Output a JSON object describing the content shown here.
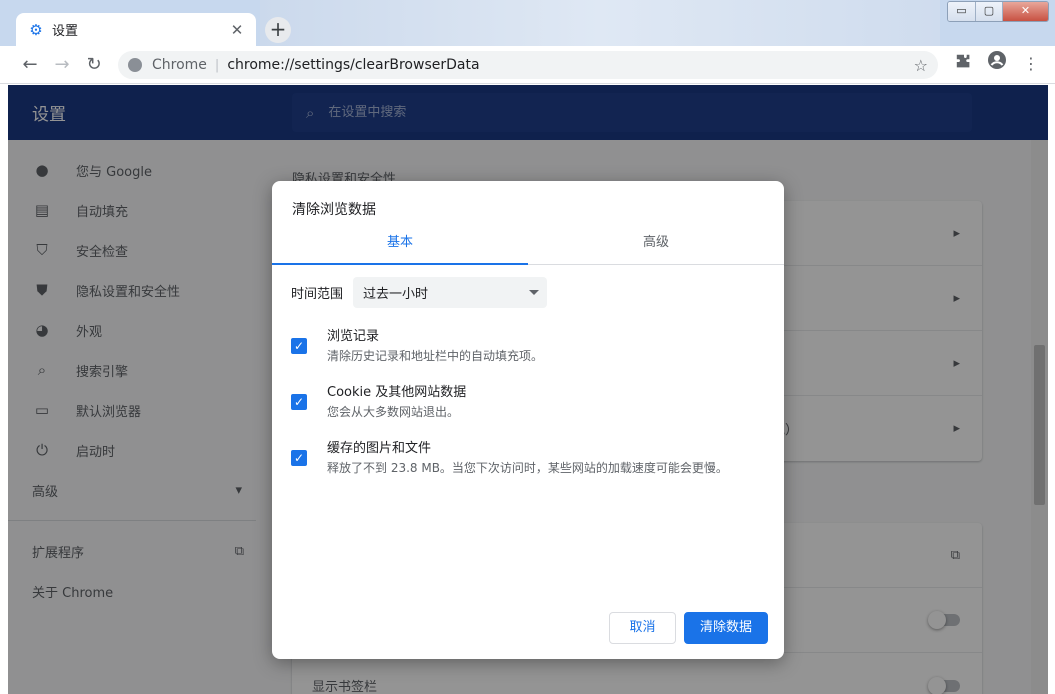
{
  "window": {
    "tab_title": "设置",
    "tab_close": "✕",
    "new_tab": "+",
    "controls": [
      "▭",
      "▢",
      "✕"
    ]
  },
  "toolbar": {
    "back": "←",
    "forward": "→",
    "reload": "↻",
    "site_chip": "Chrome",
    "url": "chrome://settings/clearBrowserData",
    "bookmark_star": "☆",
    "extensions_icon": "extension-icon",
    "profile_icon": "account-icon",
    "menu": "⋮"
  },
  "settings": {
    "title": "设置",
    "search_placeholder": "在设置中搜索",
    "sidebar": [
      {
        "label": "您与 Google",
        "icon": "person-icon"
      },
      {
        "label": "自动填充",
        "icon": "clipboard-icon"
      },
      {
        "label": "安全检查",
        "icon": "shield-check-icon"
      },
      {
        "label": "隐私设置和安全性",
        "icon": "shield-icon"
      },
      {
        "label": "外观",
        "icon": "palette-icon"
      },
      {
        "label": "搜索引擎",
        "icon": "search-icon"
      },
      {
        "label": "默认浏览器",
        "icon": "browser-icon"
      },
      {
        "label": "启动时",
        "icon": "power-icon"
      }
    ],
    "advanced": "高级",
    "extensions": "扩展程序",
    "about": "关于 Chrome",
    "section_title": "隐私设置和安全性",
    "partial_row_text": "绝）",
    "bottom_row": "显示书签栏"
  },
  "dialog": {
    "title": "清除浏览数据",
    "tabs": [
      "基本",
      "高级"
    ],
    "time_range_label": "时间范围",
    "time_range_value": "过去一小时",
    "options": [
      {
        "title": "浏览记录",
        "desc": "清除历史记录和地址栏中的自动填充项。",
        "checked": true
      },
      {
        "title": "Cookie 及其他网站数据",
        "desc": "您会从大多数网站退出。",
        "checked": true
      },
      {
        "title": "缓存的图片和文件",
        "desc": "释放了不到 23.8 MB。当您下次访问时，某些网站的加载速度可能会更慢。",
        "checked": true
      }
    ],
    "cancel": "取消",
    "clear": "清除数据"
  },
  "colors": {
    "accent": "#1a73e8",
    "header": "#1a3a86"
  }
}
